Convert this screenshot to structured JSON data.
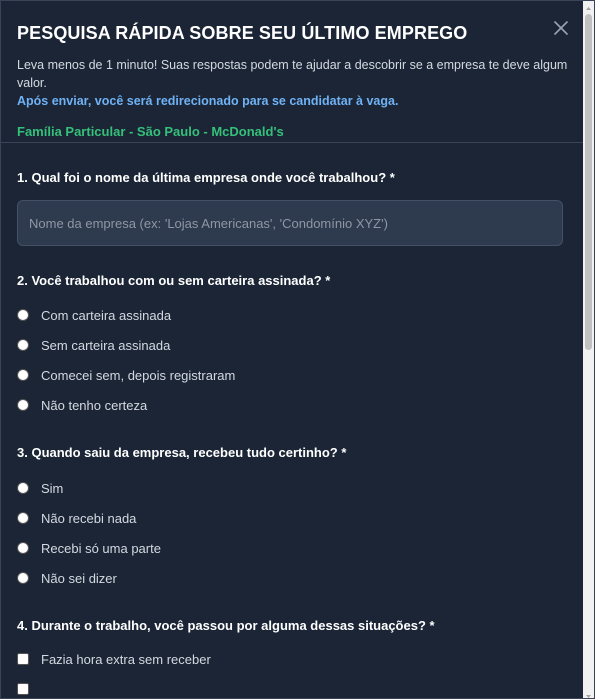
{
  "modal": {
    "title": "PESQUISA RÁPIDA SOBRE SEU ÚLTIMO EMPREGO",
    "subtitle": "Leva menos de 1 minuto! Suas respostas podem te ajudar a descobrir se a empresa te deve algum valor.",
    "redirect_note": "Após enviar, você será redirecionado para se candidatar à vaga.",
    "company_line": "Família Particular - São Paulo - McDonald's",
    "close_icon": "close-icon"
  },
  "questions": {
    "q1": {
      "label": "1. Qual foi o nome da última empresa onde você trabalhou? *",
      "placeholder": "Nome da empresa (ex: 'Lojas Americanas', 'Condomínio XYZ')",
      "value": ""
    },
    "q2": {
      "label": "2. Você trabalhou com ou sem carteira assinada? *",
      "options": [
        "Com carteira assinada",
        "Sem carteira assinada",
        "Comecei sem, depois registraram",
        "Não tenho certeza"
      ]
    },
    "q3": {
      "label": "3. Quando saiu da empresa, recebeu tudo certinho? *",
      "options": [
        "Sim",
        "Não recebi nada",
        "Recebi só uma parte",
        "Não sei dizer"
      ]
    },
    "q4": {
      "label": "4. Durante o trabalho, você passou por alguma dessas situações? *",
      "options": [
        "Fazia hora extra sem receber"
      ]
    }
  },
  "colors": {
    "background": "#1b2535",
    "accent_blue": "#6fb2f5",
    "accent_green": "#35c07a"
  }
}
